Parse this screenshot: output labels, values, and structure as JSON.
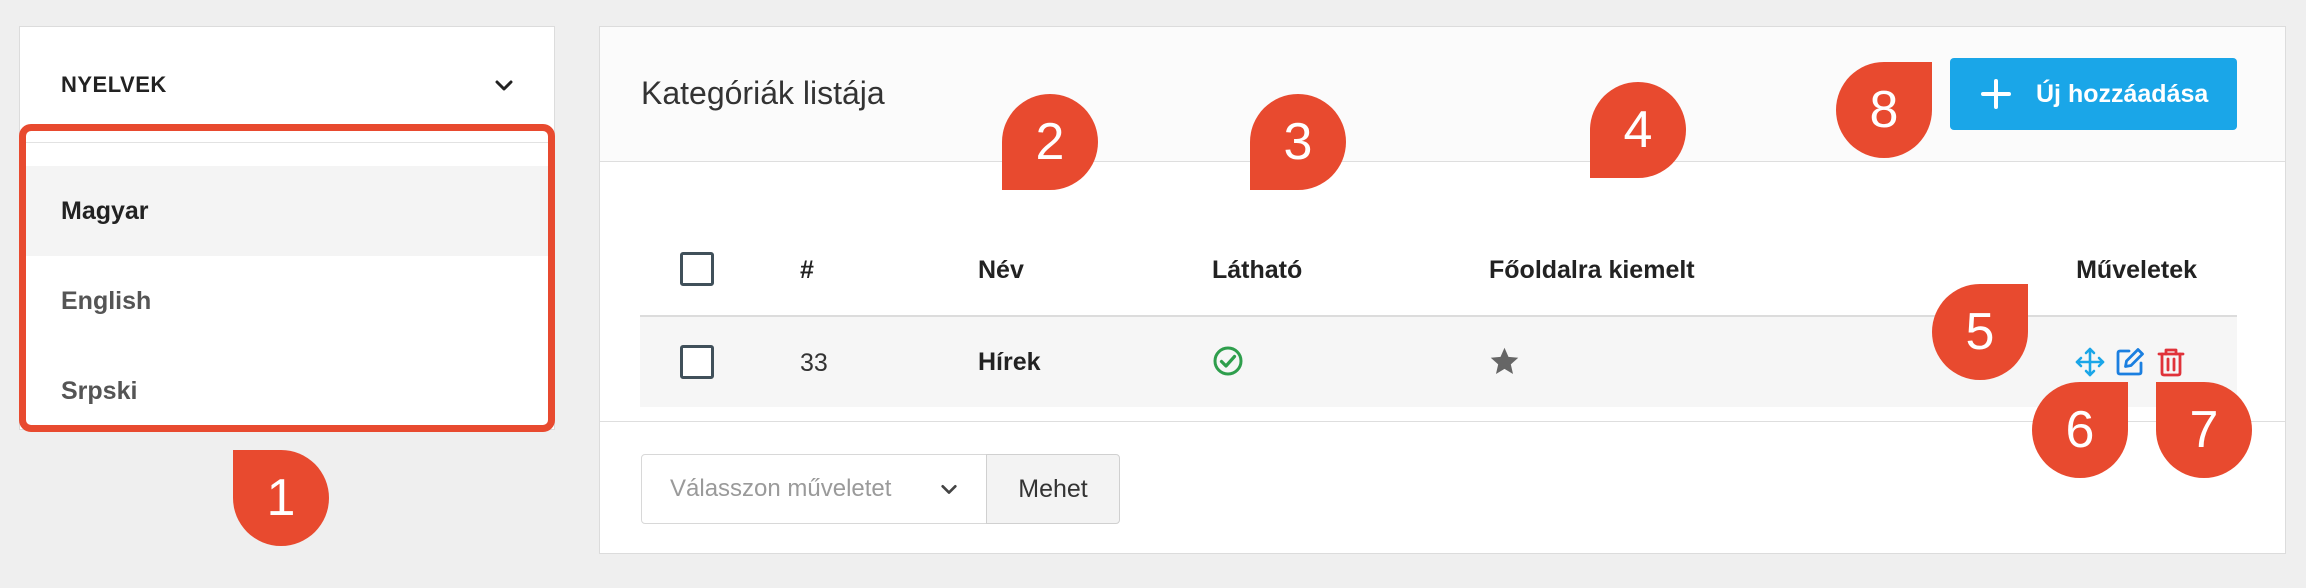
{
  "languages": {
    "title": "NYELVEK",
    "items": [
      {
        "label": "Magyar",
        "active": true
      },
      {
        "label": "English",
        "active": false
      },
      {
        "label": "Srpski",
        "active": false
      }
    ]
  },
  "card": {
    "title": "Kategóriák listája",
    "add_button": "Új hozzáadása"
  },
  "table": {
    "headers": {
      "id": "#",
      "name": "Név",
      "visible": "Látható",
      "featured": "Főoldalra kiemelt",
      "actions": "Műveletek"
    },
    "rows": [
      {
        "id": "33",
        "name": "Hírek",
        "visible": true,
        "featured": true
      }
    ]
  },
  "bulk": {
    "placeholder": "Válasszon műveletet",
    "go_button": "Mehet"
  },
  "markers": [
    "1",
    "2",
    "3",
    "4",
    "5",
    "6",
    "7",
    "8"
  ],
  "colors": {
    "accent": "#1aa6e8",
    "marker": "#e84a2f",
    "visible_check": "#2e9e4c",
    "move_icon": "#1aa6e8",
    "edit_icon": "#1b7fe0",
    "delete_icon": "#e0323a"
  }
}
